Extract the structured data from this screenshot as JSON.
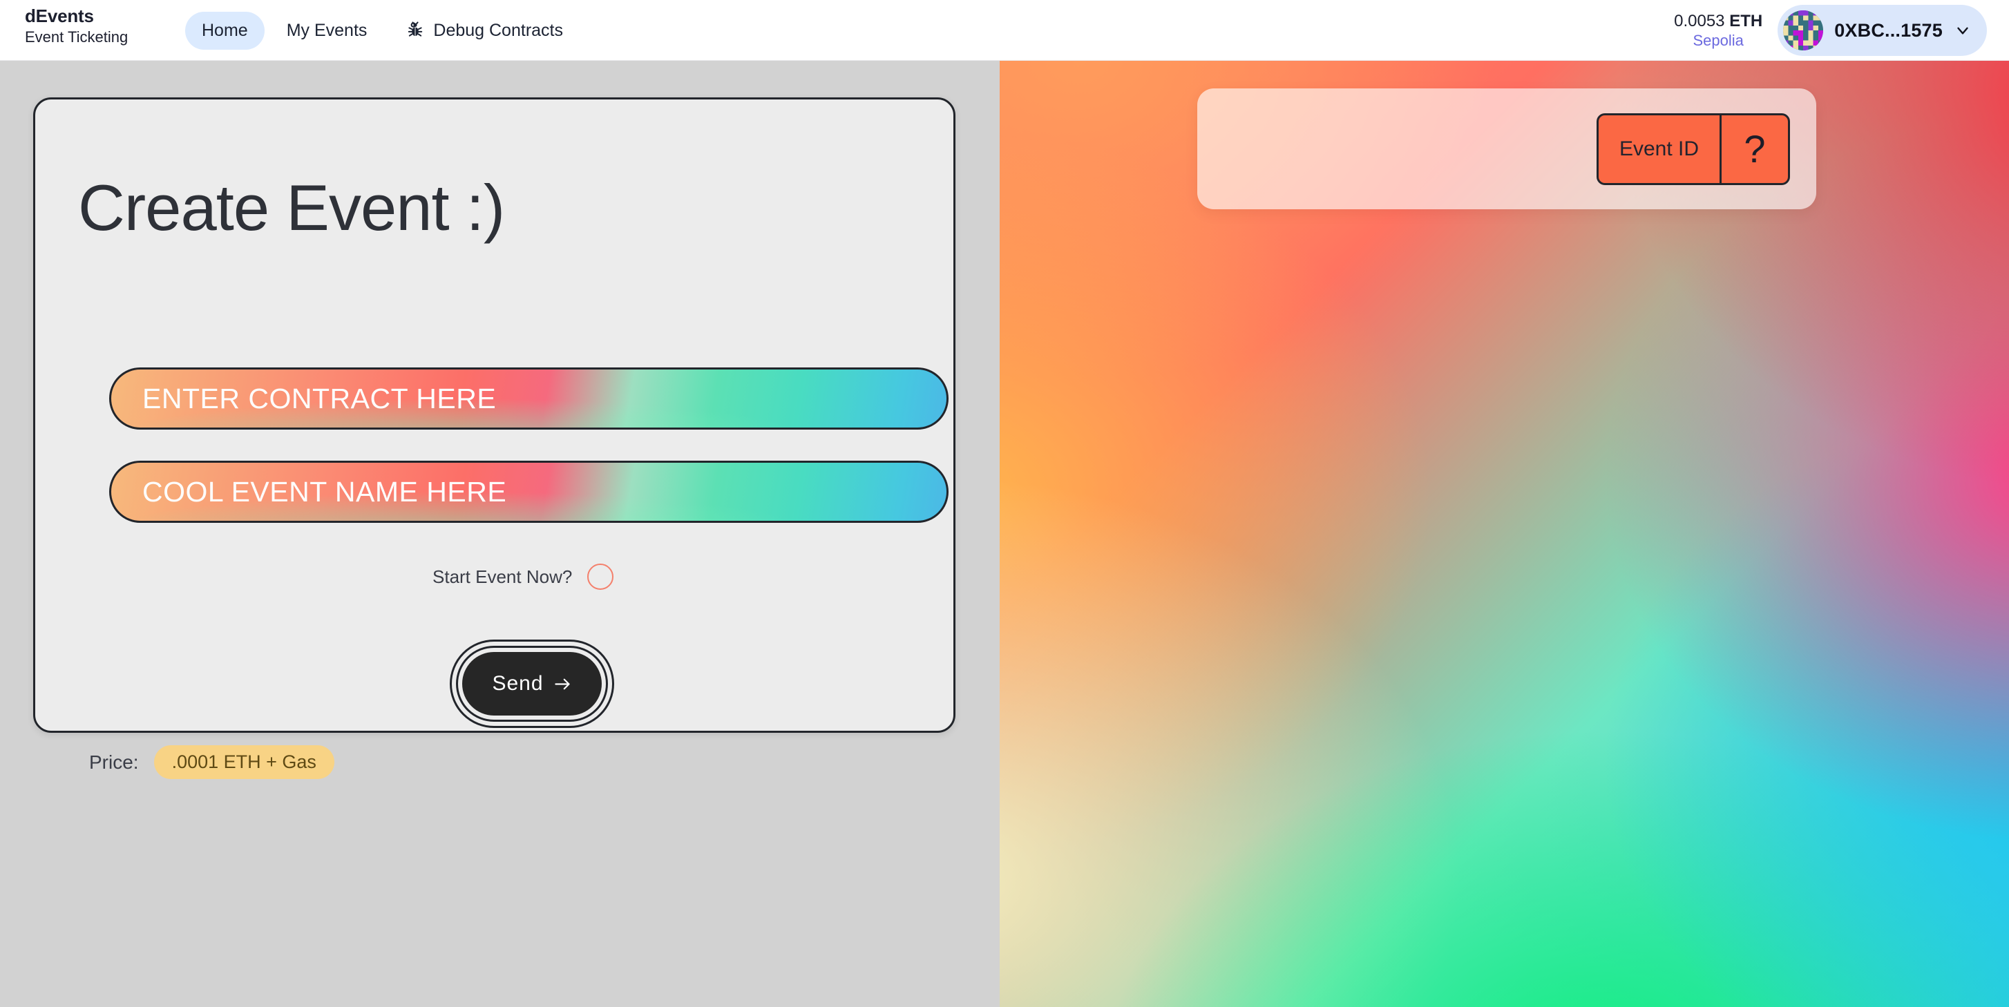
{
  "header": {
    "brand": {
      "title": "dEvents",
      "subtitle": "Event Ticketing"
    },
    "nav": [
      {
        "label": "Home",
        "icon": "",
        "active": true
      },
      {
        "label": "My Events",
        "icon": "",
        "active": false
      },
      {
        "label": "Debug Contracts",
        "icon": "bug-icon",
        "active": false
      }
    ],
    "wallet": {
      "balance_amount": "0.0053",
      "balance_unit": "ETH",
      "network": "Sepolia",
      "address": "0XBC...1575",
      "avatar_icon": "blockie-avatar",
      "chevron_icon": "chevron-down-icon",
      "pill_color": "#dbe7fb",
      "network_color": "#6b69df"
    }
  },
  "main": {
    "create_card": {
      "title": "Create Event :)",
      "contract_input": {
        "placeholder": "ENTER CONTRACT HERE",
        "value": ""
      },
      "name_input": {
        "placeholder": "COOL EVENT NAME HERE",
        "value": ""
      },
      "start_now": {
        "label": "Start Event Now?",
        "checked": false,
        "ring_color": "#f4806c"
      },
      "send_button": {
        "label": "Send",
        "arrow_icon": "arrow-right-icon",
        "bg": "#262626"
      },
      "price": {
        "label": "Price:",
        "value": ".0001 ETH + Gas",
        "badge_color": "#f8d385"
      }
    },
    "event_panel": {
      "event_id_label": "Event ID",
      "help_label": "?",
      "badge_color": "#fb6844",
      "card_bg": "rgba(255,255,255,0.62)"
    }
  },
  "theme": {
    "page_bg": "#d2d2d2",
    "card_bg": "#ececec",
    "border": "#22252b",
    "accent_blue": "#dbeafe"
  }
}
